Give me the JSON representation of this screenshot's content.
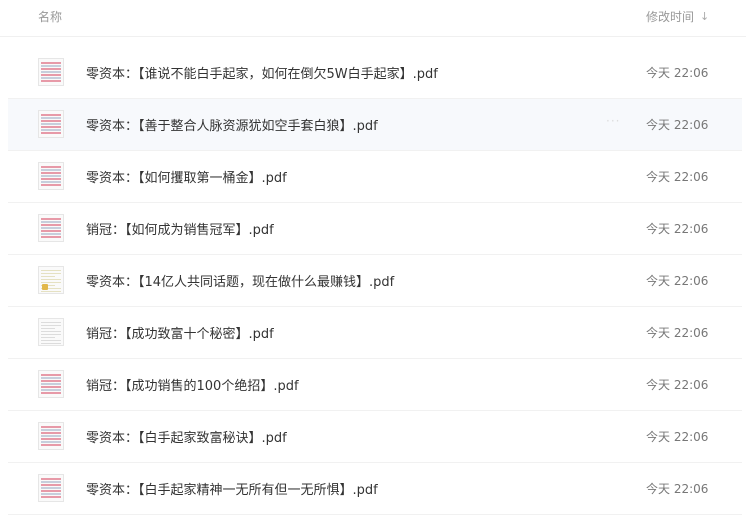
{
  "header": {
    "name_label": "名称",
    "time_label": "修改时间",
    "sort_icon": "↓"
  },
  "files": [
    {
      "name": "零资本：【谁说不能白手起家，如何在倒欠5W白手起家】.pdf",
      "time": "今天 22:06",
      "thumb": "pink"
    },
    {
      "name": "零资本：【善于整合人脉资源犹如空手套白狼】.pdf",
      "time": "今天 22:06",
      "thumb": "pink",
      "hover": true
    },
    {
      "name": "零资本：【如何攫取第一桶金】.pdf",
      "time": "今天 22:06",
      "thumb": "pink"
    },
    {
      "name": "销冠：【如何成为销售冠军】.pdf",
      "time": "今天 22:06",
      "thumb": "pink"
    },
    {
      "name": "零资本：【14亿人共同话题，现在做什么最赚钱】.pdf",
      "time": "今天 22:06",
      "thumb": "yellow"
    },
    {
      "name": "销冠：【成功致富十个秘密】.pdf",
      "time": "今天 22:06",
      "thumb": "plain"
    },
    {
      "name": "销冠：【成功销售的100个绝招】.pdf",
      "time": "今天 22:06",
      "thumb": "pink"
    },
    {
      "name": "零资本：【白手起家致富秘诀】.pdf",
      "time": "今天 22:06",
      "thumb": "pink"
    },
    {
      "name": "零资本：【白手起家精神一无所有但一无所惧】.pdf",
      "time": "今天 22:06",
      "thumb": "pink"
    }
  ]
}
